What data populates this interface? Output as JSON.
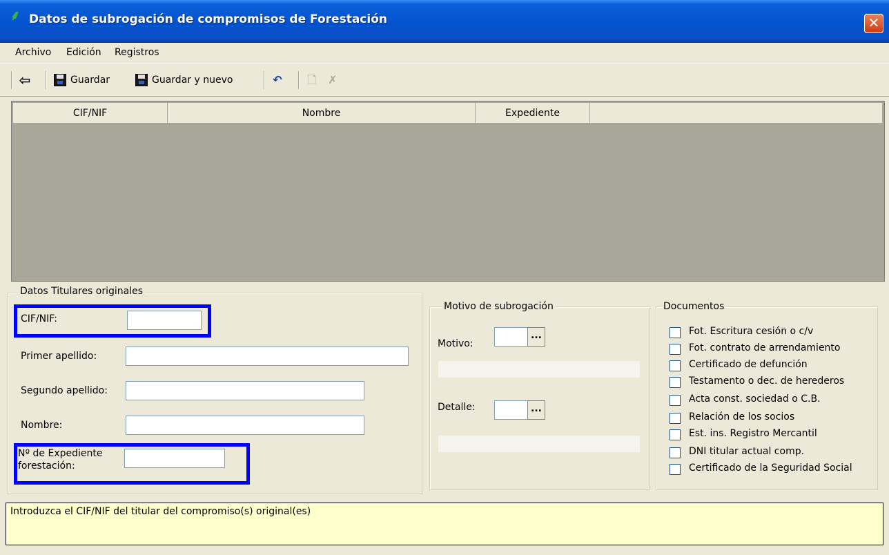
{
  "window": {
    "title": "Datos de subrogación de compromisos de Forestación",
    "app_icon": "palm-tree-icon",
    "close_glyph": "✕"
  },
  "menu": {
    "items": [
      {
        "label": "Archivo"
      },
      {
        "label": "Edición"
      },
      {
        "label": "Registros"
      }
    ]
  },
  "toolbar": {
    "back_glyph": "⇦",
    "save_label": "Guardar",
    "save_new_label": "Guardar y nuevo",
    "undo_glyph": "↶",
    "new_glyph": "🗋",
    "delete_glyph": "✗"
  },
  "grid": {
    "columns": [
      "CIF/NIF",
      "Nombre",
      "Expediente"
    ]
  },
  "titulares": {
    "group_label": "Datos Titulares originales",
    "cif_label": "CIF/NIF:",
    "cif_value": "",
    "primer_apellido_label": "Primer apellido:",
    "primer_apellido_value": "",
    "segundo_apellido_label": "Segundo apellido:",
    "segundo_apellido_value": "",
    "nombre_label": "Nombre:",
    "nombre_value": "",
    "expediente_label_1": "Nº de Expediente",
    "expediente_label_2": "forestación:",
    "expediente_value": ""
  },
  "motivo": {
    "group_label": "Motivo de subrogación",
    "motivo_label": "Motivo:",
    "detalle_label": "Detalle:",
    "ellipsis": "..."
  },
  "documentos": {
    "group_label": "Documentos",
    "items": [
      {
        "label": "Fot. Escritura cesión o c/v",
        "checked": false
      },
      {
        "label": "Fot. contrato de arrendamiento",
        "checked": false
      },
      {
        "label": "Certificado de defunción",
        "checked": false
      },
      {
        "label": "Testamento o dec. de herederos",
        "checked": false
      },
      {
        "label": "Acta const. sociedad o C.B.",
        "checked": false
      },
      {
        "label": "Relación de los socios",
        "checked": false
      },
      {
        "label": "Est. ins. Registro Mercantil",
        "checked": false
      },
      {
        "label": "DNI titular actual comp.",
        "checked": false
      },
      {
        "label": "Certificado de la Seguridad Social",
        "checked": false
      }
    ]
  },
  "status": {
    "message": "Introduzca el CIF/NIF del titular del compromiso(s) original(es)"
  },
  "colors": {
    "highlight": "#0000ff",
    "status_bg": "#ffffcc",
    "grid_bg": "#a9a79a"
  }
}
